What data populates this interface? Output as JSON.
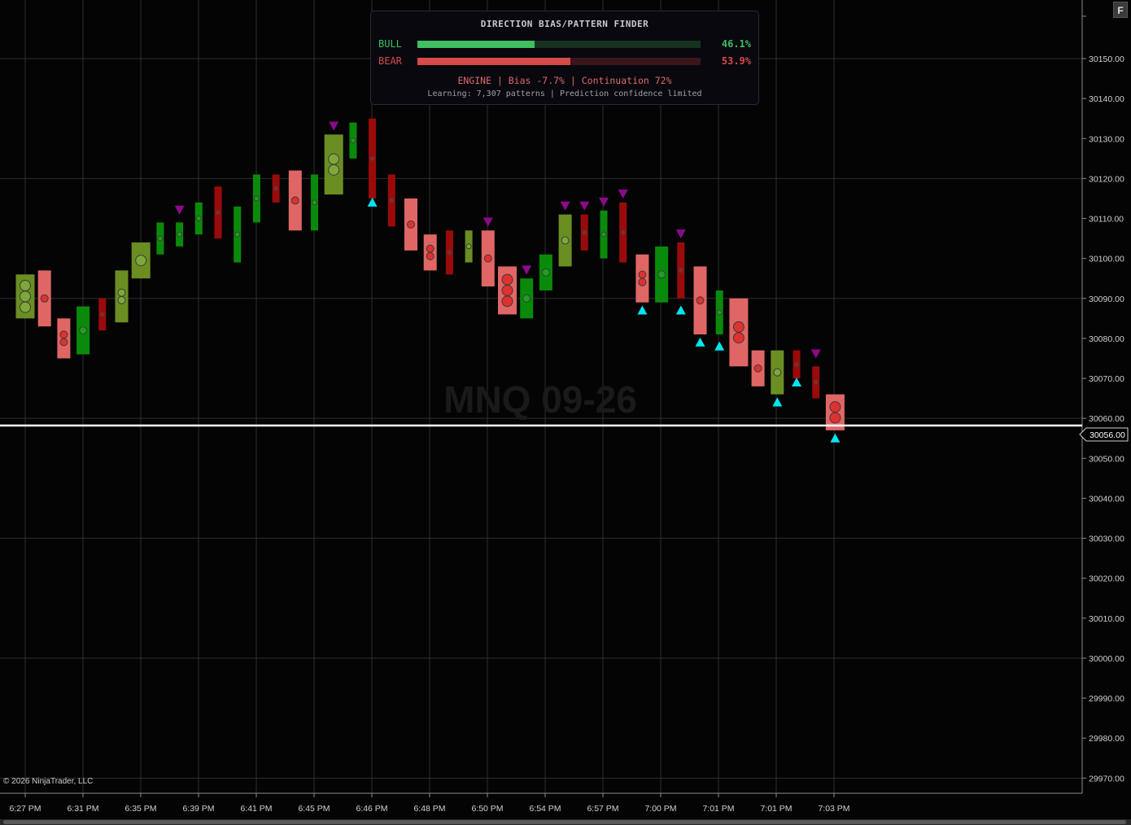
{
  "instrument_watermark": "MNQ 09-26",
  "copyright": "© 2026 NinjaTrader, LLC",
  "f_button": "F",
  "panel": {
    "title": "DIRECTION BIAS/PATTERN FINDER",
    "bull_label": "BULL",
    "bull_pct": "46.1%",
    "bull_value": 0.461,
    "bear_label": "BEAR",
    "bear_pct": "53.9%",
    "bear_value": 0.539,
    "engine_text": "ENGINE | Bias -7.7% | Continuation 72%",
    "learning_text": "Learning: 7,307 patterns | Prediction confidence limited",
    "colors": {
      "bull": "#3fbf5f",
      "bear": "#d64a4a",
      "bull_track": "#173221",
      "bear_track": "#3a1519"
    }
  },
  "colors": {
    "bull": "#0a8a0a",
    "bull_light": "#6b8e23",
    "bear": "#9b0a0a",
    "bear_light": "#e06666",
    "up_arrow": "#00e5ee",
    "down_arrow": "#8b0a8b",
    "last_price_line": "#ffffff",
    "grid": "#2e2e2e"
  },
  "chart_data": {
    "type": "box-bars",
    "ylim": [
      29965,
      30160
    ],
    "y_ticks": [
      "30150.00",
      "30140.00",
      "30130.00",
      "30120.00",
      "30110.00",
      "30100.00",
      "30090.00",
      "30080.00",
      "30070.00",
      "30060.00",
      "30050.00",
      "30040.00",
      "30030.00",
      "30020.00",
      "30010.00",
      "30000.00",
      "29990.00",
      "29980.00",
      "29970.00"
    ],
    "x_labels": [
      "6:27 PM",
      "6:31 PM",
      "6:35 PM",
      "6:39 PM",
      "6:41 PM",
      "6:45 PM",
      "6:46 PM",
      "6:48 PM",
      "6:50 PM",
      "6:54 PM",
      "6:57 PM",
      "7:00 PM",
      "7:01 PM",
      "7:01 PM",
      "7:03 PM"
    ],
    "last_price": 30056.0,
    "last_price_label": "30056.00",
    "bars": [
      {
        "open": 30096,
        "close": 30085,
        "style": "bull_light",
        "dots": 3,
        "dot_size": "big"
      },
      {
        "open": 30097,
        "close": 30083,
        "style": "bear_light",
        "dots": 1,
        "dot_size": "small"
      },
      {
        "open": 30085,
        "close": 30075,
        "style": "bear_light",
        "dots": 2,
        "dot_size": "small"
      },
      {
        "open": 30088,
        "close": 30076,
        "style": "bull",
        "dots": 1,
        "dot_size": "small"
      },
      {
        "open": 30090,
        "close": 30082,
        "style": "bear",
        "dots": 1,
        "dot_size": "tiny"
      },
      {
        "open": 30097,
        "close": 30084,
        "style": "bull_light",
        "dots": 2,
        "dot_size": "small"
      },
      {
        "open": 30104,
        "close": 30095,
        "style": "bull_light",
        "dots": 1,
        "dot_size": "big"
      },
      {
        "open": 30109,
        "close": 30101,
        "style": "bull",
        "dots": 1,
        "dot_size": "tiny"
      },
      {
        "open": 30109,
        "close": 30103,
        "style": "bull",
        "dots": 1,
        "dot_size": "tiny"
      },
      {
        "open": 30114,
        "close": 30106,
        "style": "bull",
        "dots": 1,
        "dot_size": "tiny"
      },
      {
        "open": 30118,
        "close": 30105,
        "style": "bear",
        "dots": 1,
        "dot_size": "tiny"
      },
      {
        "open": 30113,
        "close": 30099,
        "style": "bull",
        "dots": 1,
        "dot_size": "tiny"
      },
      {
        "open": 30121,
        "close": 30109,
        "style": "bull",
        "dots": 1,
        "dot_size": "tiny"
      },
      {
        "open": 30121,
        "close": 30114,
        "style": "bear",
        "dots": 1,
        "dot_size": "tiny"
      },
      {
        "open": 30122,
        "close": 30107,
        "style": "bear_light",
        "dots": 1,
        "dot_size": "small"
      },
      {
        "open": 30121,
        "close": 30107,
        "style": "bull",
        "dots": 1,
        "dot_size": "tiny"
      },
      {
        "open": 30131,
        "close": 30116,
        "style": "bull_light",
        "dots": 2,
        "dot_size": "big"
      },
      {
        "open": 30134,
        "close": 30125,
        "style": "bull",
        "dots": 1,
        "dot_size": "tiny"
      },
      {
        "open": 30135,
        "close": 30115,
        "style": "bear",
        "dots": 1,
        "dot_size": "tiny"
      },
      {
        "open": 30121,
        "close": 30108,
        "style": "bear",
        "dots": 1,
        "dot_size": "tiny"
      },
      {
        "open": 30115,
        "close": 30102,
        "style": "bear_light",
        "dots": 1,
        "dot_size": "small"
      },
      {
        "open": 30106,
        "close": 30097,
        "style": "bear_light",
        "dots": 2,
        "dot_size": "small"
      },
      {
        "open": 30107,
        "close": 30096,
        "style": "bear",
        "dots": 1,
        "dot_size": "tiny"
      },
      {
        "open": 30107,
        "close": 30099,
        "style": "bull_light",
        "dots": 1,
        "dot_size": "tiny"
      },
      {
        "open": 30107,
        "close": 30093,
        "style": "bear_light",
        "dots": 1,
        "dot_size": "small"
      },
      {
        "open": 30098,
        "close": 30086,
        "style": "bear_light",
        "dots": 3,
        "dot_size": "big"
      },
      {
        "open": 30095,
        "close": 30085,
        "style": "bull",
        "dots": 1,
        "dot_size": "small"
      },
      {
        "open": 30101,
        "close": 30092,
        "style": "bull",
        "dots": 1,
        "dot_size": "small"
      },
      {
        "open": 30111,
        "close": 30098,
        "style": "bull_light",
        "dots": 1,
        "dot_size": "small"
      },
      {
        "open": 30111,
        "close": 30102,
        "style": "bear",
        "dots": 1,
        "dot_size": "tiny"
      },
      {
        "open": 30112,
        "close": 30100,
        "style": "bull",
        "dots": 1,
        "dot_size": "tiny"
      },
      {
        "open": 30114,
        "close": 30099,
        "style": "bear",
        "dots": 1,
        "dot_size": "tiny"
      },
      {
        "open": 30101,
        "close": 30089,
        "style": "bear_light",
        "dots": 2,
        "dot_size": "small"
      },
      {
        "open": 30103,
        "close": 30089,
        "style": "bull",
        "dots": 1,
        "dot_size": "small"
      },
      {
        "open": 30104,
        "close": 30090,
        "style": "bear",
        "dots": 1,
        "dot_size": "tiny"
      },
      {
        "open": 30098,
        "close": 30081,
        "style": "bear_light",
        "dots": 1,
        "dot_size": "small"
      },
      {
        "open": 30092,
        "close": 30081,
        "style": "bull",
        "dots": 1,
        "dot_size": "tiny"
      },
      {
        "open": 30090,
        "close": 30073,
        "style": "bear_light",
        "dots": 2,
        "dot_size": "big"
      },
      {
        "open": 30077,
        "close": 30068,
        "style": "bear_light",
        "dots": 1,
        "dot_size": "small"
      },
      {
        "open": 30077,
        "close": 30066,
        "style": "bull_light",
        "dots": 1,
        "dot_size": "small"
      },
      {
        "open": 30077,
        "close": 30070,
        "style": "bear",
        "dots": 1,
        "dot_size": "tiny"
      },
      {
        "open": 30073,
        "close": 30065,
        "style": "bear",
        "dots": 1,
        "dot_size": "tiny"
      },
      {
        "open": 30066,
        "close": 30057,
        "style": "bear_light",
        "dots": 2,
        "dot_size": "big"
      }
    ],
    "down_arrows": [
      [
        8,
        30112
      ],
      [
        16,
        30133
      ],
      [
        24,
        30109
      ],
      [
        26,
        30097
      ],
      [
        28,
        30113
      ],
      [
        29,
        30113
      ],
      [
        30,
        30114
      ],
      [
        31,
        30116
      ],
      [
        34,
        30106
      ],
      [
        41,
        30076
      ]
    ],
    "up_arrows": [
      [
        18,
        30114
      ],
      [
        32,
        30087
      ],
      [
        34,
        30087
      ],
      [
        35,
        30079
      ],
      [
        36,
        30078
      ],
      [
        39,
        30064
      ],
      [
        40,
        30069
      ],
      [
        42,
        30055
      ]
    ]
  }
}
